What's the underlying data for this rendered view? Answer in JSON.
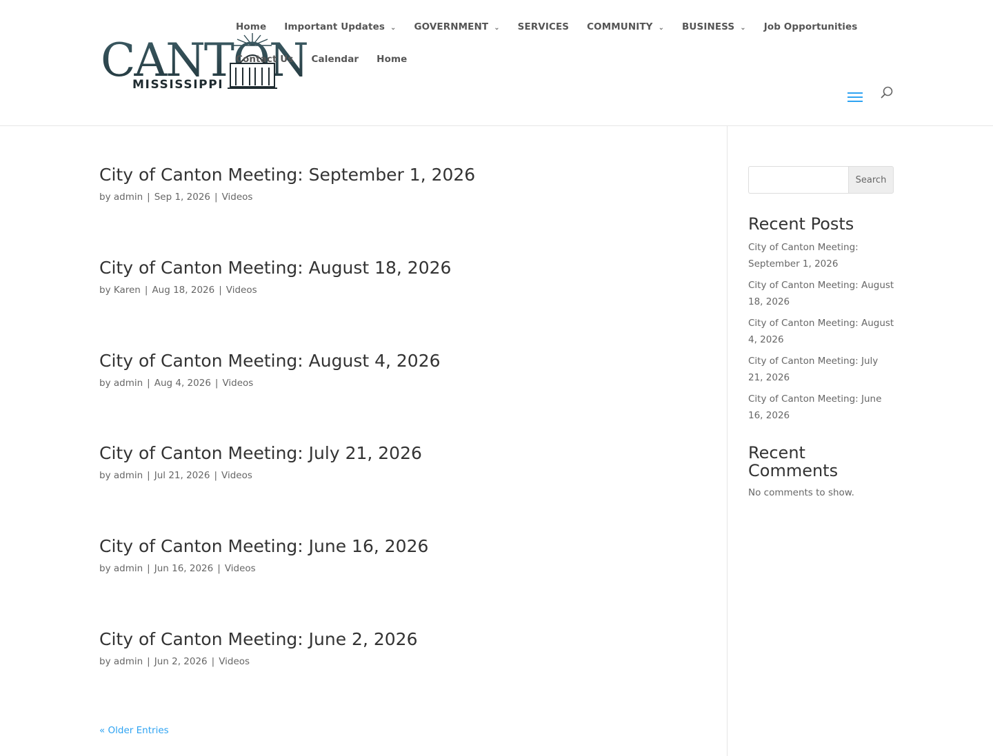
{
  "logo": {
    "wordmark": "CANTON",
    "subtitle": "MISSISSIPPI"
  },
  "nav": {
    "row1": [
      {
        "label": "Home",
        "has_dropdown": false
      },
      {
        "label": "Important Updates",
        "has_dropdown": true
      },
      {
        "label": "GOVERNMENT",
        "has_dropdown": true
      },
      {
        "label": "SERVICES",
        "has_dropdown": false
      },
      {
        "label": "COMMUNITY",
        "has_dropdown": true
      },
      {
        "label": "BUSINESS",
        "has_dropdown": true
      },
      {
        "label": "Job Opportunities",
        "has_dropdown": false
      }
    ],
    "row2": [
      {
        "label": "Contact Us",
        "has_dropdown": false
      },
      {
        "label": "Calendar",
        "has_dropdown": false
      },
      {
        "label": "Home",
        "has_dropdown": false
      }
    ],
    "dropdown_glyph": "⌄"
  },
  "header_icons": {
    "menu": "hamburger-icon",
    "search": "search-icon"
  },
  "posts": [
    {
      "title": "City of Canton Meeting: September 1, 2026",
      "by": "by",
      "author": "admin",
      "date": "Sep 1, 2026",
      "category": "Videos"
    },
    {
      "title": "City of Canton Meeting: August 18, 2026",
      "by": "by",
      "author": "Karen",
      "date": "Aug 18, 2026",
      "category": "Videos"
    },
    {
      "title": "City of Canton Meeting: August 4, 2026",
      "by": "by",
      "author": "admin",
      "date": "Aug 4, 2026",
      "category": "Videos"
    },
    {
      "title": "City of Canton Meeting: July 21, 2026",
      "by": "by",
      "author": "admin",
      "date": "Jul 21, 2026",
      "category": "Videos"
    },
    {
      "title": "City of Canton Meeting: June 16, 2026",
      "by": "by",
      "author": "admin",
      "date": "Jun 16, 2026",
      "category": "Videos"
    },
    {
      "title": "City of Canton Meeting: June 2, 2026",
      "by": "by",
      "author": "admin",
      "date": "Jun 2, 2026",
      "category": "Videos"
    }
  ],
  "meta_separator": "|",
  "pagination": {
    "older_label": "« Older Entries"
  },
  "sidebar": {
    "search": {
      "value": "",
      "placeholder": "",
      "button_label": "Search"
    },
    "recent_posts_title": "Recent Posts",
    "recent_posts": [
      "City of Canton Meeting: September 1, 2026",
      "City of Canton Meeting: August 18, 2026",
      "City of Canton Meeting: August 4, 2026",
      "City of Canton Meeting: July 21, 2026",
      "City of Canton Meeting: June 16, 2026"
    ],
    "recent_comments_title": "Recent Comments",
    "no_comments_text": "No comments to show."
  },
  "colors": {
    "accent": "#2ea3f2",
    "heading": "#333333",
    "body_text": "#666666",
    "logo_teal": "#2f4a52",
    "logo_dark": "#1f2b30"
  }
}
